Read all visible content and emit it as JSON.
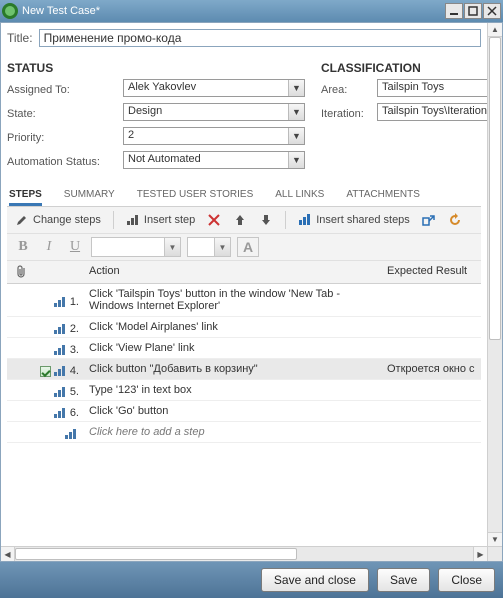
{
  "window": {
    "title": "New Test Case*"
  },
  "title": {
    "label": "Title:",
    "value": "Применение промо-кода"
  },
  "status": {
    "heading": "STATUS",
    "fields": {
      "assigned_to": {
        "label": "Assigned To:",
        "value": "Alek Yakovlev"
      },
      "state": {
        "label": "State:",
        "value": "Design"
      },
      "priority": {
        "label": "Priority:",
        "value": "2"
      },
      "automation": {
        "label": "Automation Status:",
        "value": "Not Automated"
      }
    }
  },
  "classification": {
    "heading": "CLASSIFICATION",
    "fields": {
      "area": {
        "label": "Area:",
        "value": "Tailspin Toys"
      },
      "iteration": {
        "label": "Iteration:",
        "value": "Tailspin Toys\\Iteration"
      }
    }
  },
  "tabs": [
    "STEPS",
    "SUMMARY",
    "TESTED USER STORIES",
    "ALL LINKS",
    "ATTACHMENTS"
  ],
  "tabs_active_index": 0,
  "toolbar": {
    "change_steps": "Change steps",
    "insert_step": "Insert step",
    "insert_shared": "Insert shared steps"
  },
  "columns": {
    "action": "Action",
    "expected": "Expected Result"
  },
  "steps": [
    {
      "num": "1.",
      "action": "Click 'Tailspin Toys' button in the window 'New Tab - Windows Internet Explorer'",
      "expected": "",
      "selected": false,
      "validated": false
    },
    {
      "num": "2.",
      "action": "Click 'Model Airplanes' link",
      "expected": "",
      "selected": false,
      "validated": false
    },
    {
      "num": "3.",
      "action": "Click 'View Plane' link",
      "expected": "",
      "selected": false,
      "validated": false
    },
    {
      "num": "4.",
      "action": "Click button \"Добавить в корзину\"",
      "expected": "Откроется окно с",
      "selected": true,
      "validated": true
    },
    {
      "num": "5.",
      "action": "Type '123' in text box",
      "expected": "",
      "selected": false,
      "validated": false
    },
    {
      "num": "6.",
      "action": "Click 'Go' button",
      "expected": "",
      "selected": false,
      "validated": false
    }
  ],
  "add_step_placeholder": "Click here to add a step",
  "footer": {
    "save_close": "Save and close",
    "save": "Save",
    "close": "Close"
  },
  "icons": {
    "step_bars": "step-indicator-icon",
    "attachment": "paperclip-icon"
  }
}
